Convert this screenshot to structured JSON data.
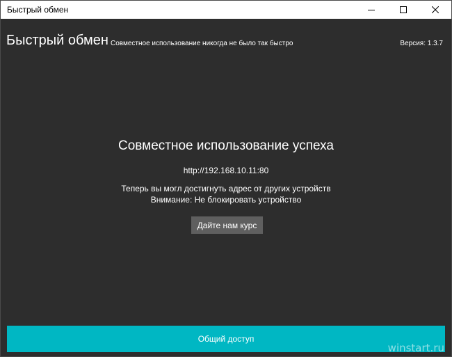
{
  "window": {
    "title": "Быстрый обмен"
  },
  "header": {
    "app_title": "Быстрый обмен",
    "subtitle": "Совместное использование никогда не было так быстро",
    "version": "Версия: 1.3.7"
  },
  "main": {
    "heading": "Совместное использование успеха",
    "url": "http://192.168.10.11:80",
    "info_line1": "Теперь вы могл достигнуть адрес от других устройств",
    "info_line2": "Внимание: Не блокировать устройство",
    "rate_button_label": "Дайте нам курс"
  },
  "footer": {
    "share_button_label": "Общий доступ"
  },
  "watermark": "winstart.ru",
  "colors": {
    "accent": "#00b7c3",
    "background": "#2d2d2d",
    "button_gray": "#5f5f5f"
  },
  "icons": {
    "minimize": "minimize-icon",
    "maximize": "maximize-icon",
    "close": "close-icon"
  }
}
